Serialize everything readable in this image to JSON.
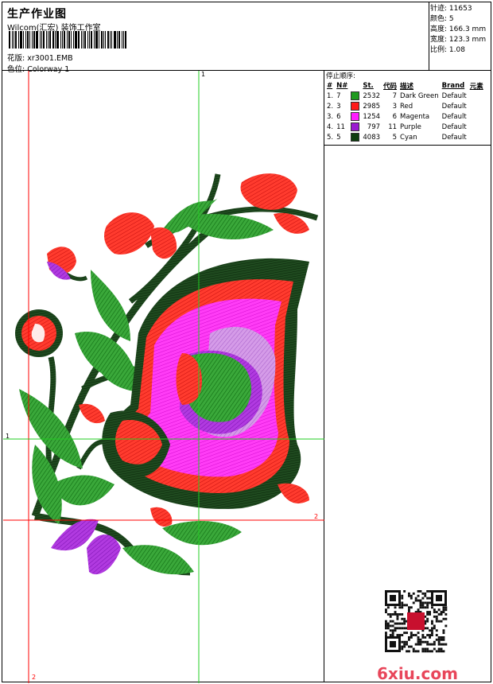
{
  "header": {
    "title": "生产作业图",
    "studio": "Wilcom(汇宏) 装饰工作室",
    "design_label": "花版:",
    "design_file": "xr3001.EMB",
    "colorway_label": "色位:",
    "colorway": "Colorway 1"
  },
  "stats": {
    "stitches_label": "针迹:",
    "stitches": "11653",
    "colors_label": "颜色:",
    "colors": "5",
    "height_label": "高度:",
    "height": "166.3 mm",
    "width_label": "宽度:",
    "width": "123.3 mm",
    "scale_label": "比例:",
    "scale": "1.08"
  },
  "stop_sequence": {
    "caption": "停止顺序:",
    "columns": [
      "#",
      "N#",
      "St.",
      "代码",
      "描述",
      "Brand",
      "元素"
    ],
    "rows": [
      {
        "idx": "1.",
        "n": "7",
        "color": "#1e9a1e",
        "st": "2532",
        "code": "7",
        "desc": "Dark Green",
        "brand": "Default"
      },
      {
        "idx": "2.",
        "n": "3",
        "color": "#ff1a1a",
        "st": "2985",
        "code": "3",
        "desc": "Red",
        "brand": "Default"
      },
      {
        "idx": "3.",
        "n": "6",
        "color": "#ff1aff",
        "st": "1254",
        "code": "6",
        "desc": "Magenta",
        "brand": "Default"
      },
      {
        "idx": "4.",
        "n": "11",
        "color": "#9b1ad0",
        "st": "797",
        "code": "11",
        "desc": "Purple",
        "brand": "Default"
      },
      {
        "idx": "5.",
        "n": "5",
        "color": "#0e3d0e",
        "st": "4083",
        "code": "5",
        "desc": "Cyan",
        "brand": "Default"
      }
    ]
  },
  "canvas": {
    "marker_1_top": "1",
    "marker_1_left": "1",
    "marker_2_right": "2",
    "marker_2_bottom": "2"
  },
  "watermark": {
    "site": "6xiu.com"
  }
}
